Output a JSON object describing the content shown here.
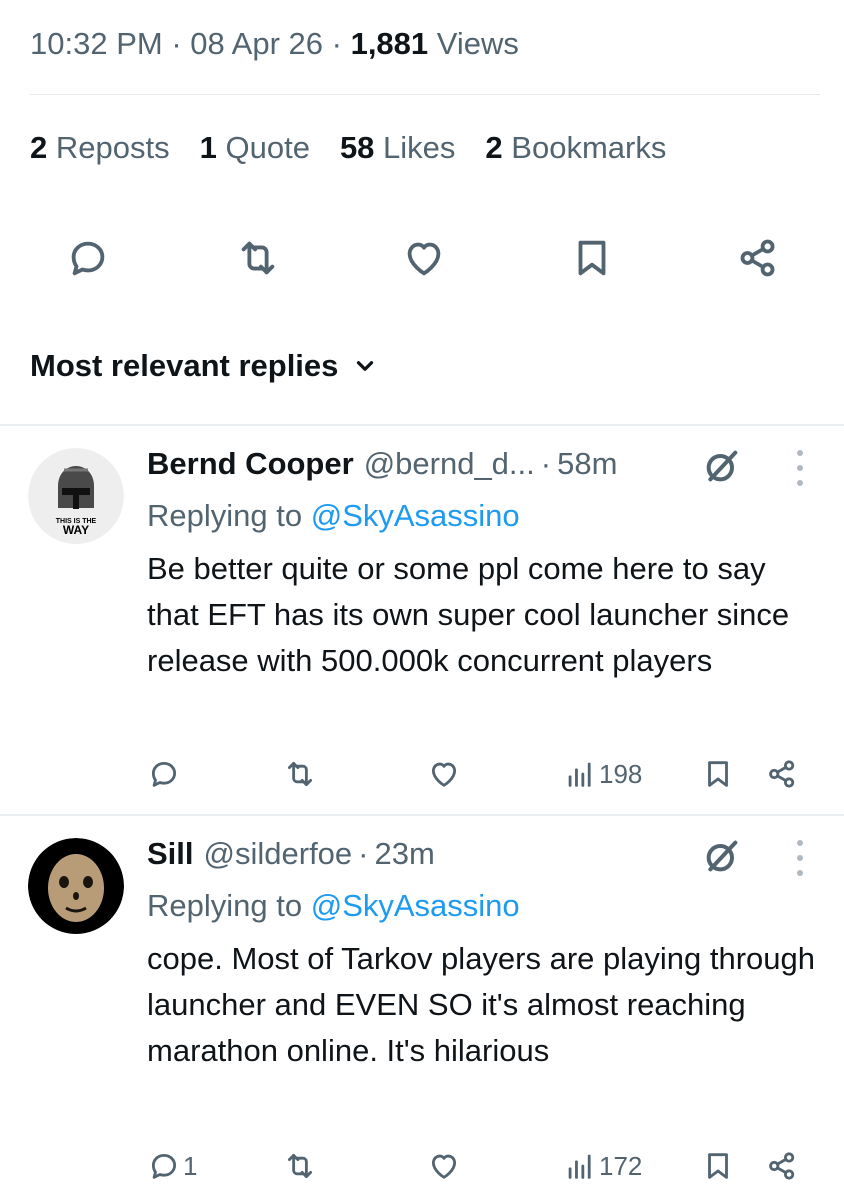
{
  "tweet_meta": {
    "time": "10:32 PM",
    "separator": "·",
    "date": "08 Apr 26",
    "views_count": "1,881",
    "views_label": "Views"
  },
  "stats": [
    {
      "count": "2",
      "label": "Reposts"
    },
    {
      "count": "1",
      "label": "Quote"
    },
    {
      "count": "58",
      "label": "Likes"
    },
    {
      "count": "2",
      "label": "Bookmarks"
    }
  ],
  "action_bar": {
    "icons": [
      "reply-icon",
      "repost-icon",
      "like-icon",
      "bookmark-icon",
      "share-icon"
    ]
  },
  "sort": {
    "label": "Most relevant replies",
    "icon": "chevron-down-icon"
  },
  "replies": [
    {
      "name": "Bernd Cooper",
      "handle": "@bernd_d...",
      "dot": "·",
      "time": "58m",
      "replying_prefix": "Replying to",
      "replying_to": "@SkyAsassino",
      "text": "Be better quite or some ppl come here to say that EFT has its own super cool launcher since release with 500.000k concurrent players",
      "avatar_caption_top": "THIS IS THE",
      "avatar_caption_bottom": "WAY",
      "reply_count": "",
      "views": "198"
    },
    {
      "name": "Sill",
      "handle": "@silderfoe",
      "dot": "·",
      "time": "23m",
      "replying_prefix": "Replying to",
      "replying_to": "@SkyAsassino",
      "text": "cope. Most of Tarkov players are playing through launcher and EVEN SO it's almost reaching marathon online. It's hilarious",
      "reply_count": "1",
      "views": "172"
    }
  ],
  "colors": {
    "text": "#0f1419",
    "muted": "#536471",
    "link": "#1d9bf0",
    "divider": "#eceff1"
  }
}
